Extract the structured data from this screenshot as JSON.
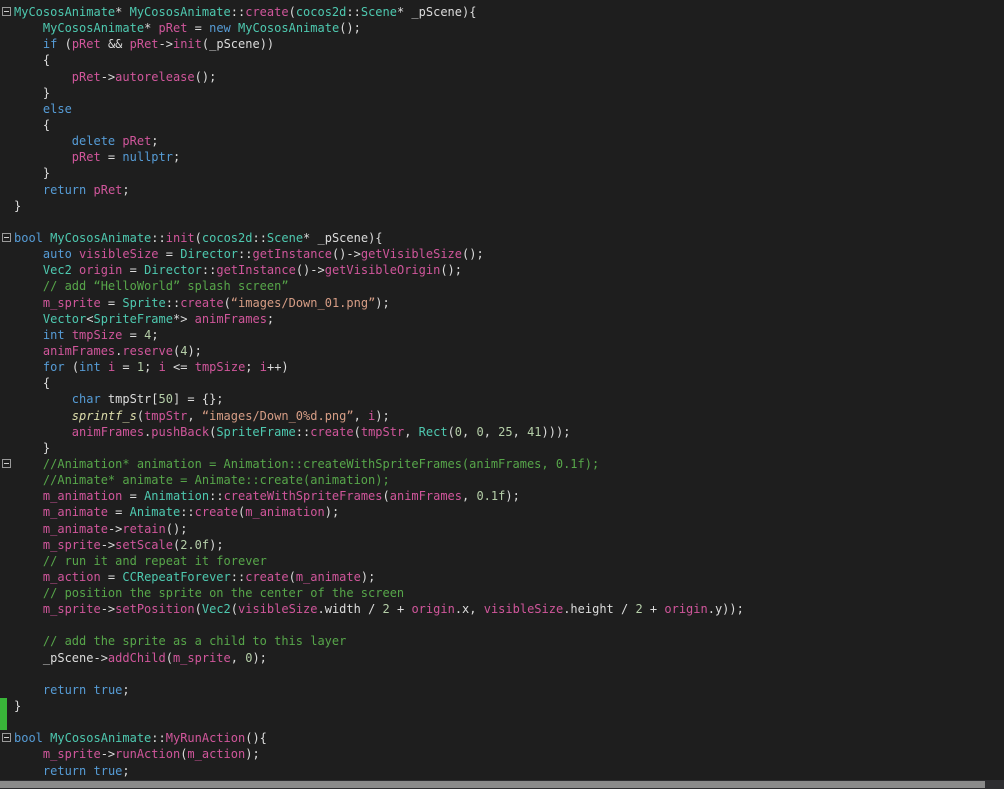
{
  "editor": {
    "colors": {
      "background": "#1E1E1E",
      "t": "#4EC9B0",
      "f": "#D0569B",
      "k": "#569CD6",
      "c": "#57A64A",
      "s": "#D69D85",
      "p": "#DCDCDC",
      "n": "#B5CEA8",
      "m": "#DCDCAA",
      "change": "#39B539",
      "foldborder": "#999999",
      "foldglyph": "#CCCCCC",
      "sbtrack": "#2D2D30",
      "sbthumb": "#8A8A8A"
    },
    "lines": [
      {
        "fold": true,
        "tokens": [
          [
            "t",
            "MyCososAnimate"
          ],
          [
            "p",
            "* "
          ],
          [
            "t",
            "MyCososAnimate"
          ],
          [
            "p",
            "::"
          ],
          [
            "f",
            "create"
          ],
          [
            "p",
            "("
          ],
          [
            "t",
            "cocos2d"
          ],
          [
            "p",
            "::"
          ],
          [
            "t",
            "Scene"
          ],
          [
            "p",
            "* _pScene){"
          ]
        ]
      },
      {
        "tokens": [
          [
            "p",
            "    "
          ],
          [
            "t",
            "MyCososAnimate"
          ],
          [
            "p",
            "* "
          ],
          [
            "f",
            "pRet"
          ],
          [
            "p",
            " = "
          ],
          [
            "k",
            "new"
          ],
          [
            "p",
            " "
          ],
          [
            "t",
            "MyCososAnimate"
          ],
          [
            "p",
            "();"
          ]
        ]
      },
      {
        "tokens": [
          [
            "p",
            "    "
          ],
          [
            "k",
            "if"
          ],
          [
            "p",
            " ("
          ],
          [
            "f",
            "pRet"
          ],
          [
            "p",
            " && "
          ],
          [
            "f",
            "pRet"
          ],
          [
            "p",
            "->"
          ],
          [
            "f",
            "init"
          ],
          [
            "p",
            "(_pScene))"
          ]
        ]
      },
      {
        "tokens": [
          [
            "p",
            "    {"
          ]
        ]
      },
      {
        "tokens": [
          [
            "p",
            "        "
          ],
          [
            "f",
            "pRet"
          ],
          [
            "p",
            "->"
          ],
          [
            "f",
            "autorelease"
          ],
          [
            "p",
            "();"
          ]
        ]
      },
      {
        "tokens": [
          [
            "p",
            "    }"
          ]
        ]
      },
      {
        "tokens": [
          [
            "p",
            "    "
          ],
          [
            "k",
            "else"
          ]
        ]
      },
      {
        "tokens": [
          [
            "p",
            "    {"
          ]
        ]
      },
      {
        "tokens": [
          [
            "p",
            "        "
          ],
          [
            "k",
            "delete"
          ],
          [
            "p",
            " "
          ],
          [
            "f",
            "pRet"
          ],
          [
            "p",
            ";"
          ]
        ]
      },
      {
        "tokens": [
          [
            "p",
            "        "
          ],
          [
            "f",
            "pRet"
          ],
          [
            "p",
            " = "
          ],
          [
            "k",
            "nullptr"
          ],
          [
            "p",
            ";"
          ]
        ]
      },
      {
        "tokens": [
          [
            "p",
            "    }"
          ]
        ]
      },
      {
        "tokens": [
          [
            "p",
            "    "
          ],
          [
            "k",
            "return"
          ],
          [
            "p",
            " "
          ],
          [
            "f",
            "pRet"
          ],
          [
            "p",
            ";"
          ]
        ]
      },
      {
        "tokens": [
          [
            "p",
            "}"
          ]
        ]
      },
      {
        "tokens": []
      },
      {
        "fold": true,
        "tokens": [
          [
            "k",
            "bool"
          ],
          [
            "p",
            " "
          ],
          [
            "t",
            "MyCososAnimate"
          ],
          [
            "p",
            "::"
          ],
          [
            "f",
            "init"
          ],
          [
            "p",
            "("
          ],
          [
            "t",
            "cocos2d"
          ],
          [
            "p",
            "::"
          ],
          [
            "t",
            "Scene"
          ],
          [
            "p",
            "* _pScene){"
          ]
        ]
      },
      {
        "tokens": [
          [
            "p",
            "    "
          ],
          [
            "k",
            "auto"
          ],
          [
            "p",
            " "
          ],
          [
            "f",
            "visibleSize"
          ],
          [
            "p",
            " = "
          ],
          [
            "t",
            "Director"
          ],
          [
            "p",
            "::"
          ],
          [
            "f",
            "getInstance"
          ],
          [
            "p",
            "()->"
          ],
          [
            "f",
            "getVisibleSize"
          ],
          [
            "p",
            "();"
          ]
        ]
      },
      {
        "tokens": [
          [
            "p",
            "    "
          ],
          [
            "t",
            "Vec2"
          ],
          [
            "p",
            " "
          ],
          [
            "f",
            "origin"
          ],
          [
            "p",
            " = "
          ],
          [
            "t",
            "Director"
          ],
          [
            "p",
            "::"
          ],
          [
            "f",
            "getInstance"
          ],
          [
            "p",
            "()->"
          ],
          [
            "f",
            "getVisibleOrigin"
          ],
          [
            "p",
            "();"
          ]
        ]
      },
      {
        "tokens": [
          [
            "p",
            "    "
          ],
          [
            "c",
            "// add “HelloWorld” splash screen”"
          ]
        ]
      },
      {
        "tokens": [
          [
            "p",
            "    "
          ],
          [
            "f",
            "m_sprite"
          ],
          [
            "p",
            " = "
          ],
          [
            "t",
            "Sprite"
          ],
          [
            "p",
            "::"
          ],
          [
            "f",
            "create"
          ],
          [
            "p",
            "("
          ],
          [
            "s",
            "“images/Down_01.png”"
          ],
          [
            "p",
            ");"
          ]
        ]
      },
      {
        "tokens": [
          [
            "p",
            "    "
          ],
          [
            "t",
            "Vector"
          ],
          [
            "p",
            "<"
          ],
          [
            "t",
            "SpriteFrame"
          ],
          [
            "p",
            "*> "
          ],
          [
            "f",
            "animFrames"
          ],
          [
            "p",
            ";"
          ]
        ]
      },
      {
        "tokens": [
          [
            "p",
            "    "
          ],
          [
            "k",
            "int"
          ],
          [
            "p",
            " "
          ],
          [
            "f",
            "tmpSize"
          ],
          [
            "p",
            " = "
          ],
          [
            "n",
            "4"
          ],
          [
            "p",
            ";"
          ]
        ]
      },
      {
        "tokens": [
          [
            "p",
            "    "
          ],
          [
            "f",
            "animFrames"
          ],
          [
            "p",
            "."
          ],
          [
            "f",
            "reserve"
          ],
          [
            "p",
            "("
          ],
          [
            "n",
            "4"
          ],
          [
            "p",
            ");"
          ]
        ]
      },
      {
        "tokens": [
          [
            "p",
            "    "
          ],
          [
            "k",
            "for"
          ],
          [
            "p",
            " ("
          ],
          [
            "k",
            "int"
          ],
          [
            "p",
            " "
          ],
          [
            "f",
            "i"
          ],
          [
            "p",
            " = "
          ],
          [
            "n",
            "1"
          ],
          [
            "p",
            "; "
          ],
          [
            "f",
            "i"
          ],
          [
            "p",
            " <= "
          ],
          [
            "f",
            "tmpSize"
          ],
          [
            "p",
            "; "
          ],
          [
            "f",
            "i"
          ],
          [
            "p",
            "++)"
          ]
        ]
      },
      {
        "tokens": [
          [
            "p",
            "    {"
          ]
        ]
      },
      {
        "tokens": [
          [
            "p",
            "        "
          ],
          [
            "k",
            "char"
          ],
          [
            "p",
            " tmpStr["
          ],
          [
            "n",
            "50"
          ],
          [
            "p",
            "] = {};"
          ]
        ]
      },
      {
        "tokens": [
          [
            "p",
            "        "
          ],
          [
            "m",
            "sprintf_s"
          ],
          [
            "p",
            "("
          ],
          [
            "f",
            "tmpStr"
          ],
          [
            "p",
            ", "
          ],
          [
            "s",
            "“images/Down_0%d.png”"
          ],
          [
            "p",
            ", "
          ],
          [
            "f",
            "i"
          ],
          [
            "p",
            ");"
          ]
        ]
      },
      {
        "tokens": [
          [
            "p",
            "        "
          ],
          [
            "f",
            "animFrames"
          ],
          [
            "p",
            "."
          ],
          [
            "f",
            "pushBack"
          ],
          [
            "p",
            "("
          ],
          [
            "t",
            "SpriteFrame"
          ],
          [
            "p",
            "::"
          ],
          [
            "f",
            "create"
          ],
          [
            "p",
            "("
          ],
          [
            "f",
            "tmpStr"
          ],
          [
            "p",
            ", "
          ],
          [
            "t",
            "Rect"
          ],
          [
            "p",
            "("
          ],
          [
            "n",
            "0"
          ],
          [
            "p",
            ", "
          ],
          [
            "n",
            "0"
          ],
          [
            "p",
            ", "
          ],
          [
            "n",
            "25"
          ],
          [
            "p",
            ", "
          ],
          [
            "n",
            "41"
          ],
          [
            "p",
            ")));"
          ]
        ]
      },
      {
        "tokens": [
          [
            "p",
            "    }"
          ]
        ]
      },
      {
        "fold": true,
        "tokens": [
          [
            "p",
            "    "
          ],
          [
            "c",
            "//Animation* animation = Animation::createWithSpriteFrames(animFrames, 0.1f);"
          ]
        ]
      },
      {
        "tokens": [
          [
            "p",
            "    "
          ],
          [
            "c",
            "//Animate* animate = Animate::create(animation);"
          ]
        ]
      },
      {
        "tokens": [
          [
            "p",
            "    "
          ],
          [
            "f",
            "m_animation"
          ],
          [
            "p",
            " = "
          ],
          [
            "t",
            "Animation"
          ],
          [
            "p",
            "::"
          ],
          [
            "f",
            "createWithSpriteFrames"
          ],
          [
            "p",
            "("
          ],
          [
            "f",
            "animFrames"
          ],
          [
            "p",
            ", "
          ],
          [
            "n",
            "0.1f"
          ],
          [
            "p",
            ");"
          ]
        ]
      },
      {
        "tokens": [
          [
            "p",
            "    "
          ],
          [
            "f",
            "m_animate"
          ],
          [
            "p",
            " = "
          ],
          [
            "t",
            "Animate"
          ],
          [
            "p",
            "::"
          ],
          [
            "f",
            "create"
          ],
          [
            "p",
            "("
          ],
          [
            "f",
            "m_animation"
          ],
          [
            "p",
            ");"
          ]
        ]
      },
      {
        "tokens": [
          [
            "p",
            "    "
          ],
          [
            "f",
            "m_animate"
          ],
          [
            "p",
            "->"
          ],
          [
            "f",
            "retain"
          ],
          [
            "p",
            "();"
          ]
        ]
      },
      {
        "tokens": [
          [
            "p",
            "    "
          ],
          [
            "f",
            "m_sprite"
          ],
          [
            "p",
            "->"
          ],
          [
            "f",
            "setScale"
          ],
          [
            "p",
            "("
          ],
          [
            "n",
            "2.0f"
          ],
          [
            "p",
            ");"
          ]
        ]
      },
      {
        "tokens": [
          [
            "p",
            "    "
          ],
          [
            "c",
            "// run it and repeat it forever"
          ]
        ]
      },
      {
        "tokens": [
          [
            "p",
            "    "
          ],
          [
            "f",
            "m_action"
          ],
          [
            "p",
            " = "
          ],
          [
            "t",
            "CCRepeatForever"
          ],
          [
            "p",
            "::"
          ],
          [
            "f",
            "create"
          ],
          [
            "p",
            "("
          ],
          [
            "f",
            "m_animate"
          ],
          [
            "p",
            ");"
          ]
        ]
      },
      {
        "tokens": [
          [
            "p",
            "    "
          ],
          [
            "c",
            "// position the sprite on the center of the screen"
          ]
        ]
      },
      {
        "tokens": [
          [
            "p",
            "    "
          ],
          [
            "f",
            "m_sprite"
          ],
          [
            "p",
            "->"
          ],
          [
            "f",
            "setPosition"
          ],
          [
            "p",
            "("
          ],
          [
            "t",
            "Vec2"
          ],
          [
            "p",
            "("
          ],
          [
            "f",
            "visibleSize"
          ],
          [
            "p",
            ".width / "
          ],
          [
            "n",
            "2"
          ],
          [
            "p",
            " + "
          ],
          [
            "f",
            "origin"
          ],
          [
            "p",
            ".x, "
          ],
          [
            "f",
            "visibleSize"
          ],
          [
            "p",
            ".height / "
          ],
          [
            "n",
            "2"
          ],
          [
            "p",
            " + "
          ],
          [
            "f",
            "origin"
          ],
          [
            "p",
            ".y));"
          ]
        ]
      },
      {
        "tokens": []
      },
      {
        "tokens": [
          [
            "p",
            "    "
          ],
          [
            "c",
            "// add the sprite as a child to this layer"
          ]
        ]
      },
      {
        "tokens": [
          [
            "p",
            "    _pScene->"
          ],
          [
            "f",
            "addChild"
          ],
          [
            "p",
            "("
          ],
          [
            "f",
            "m_sprite"
          ],
          [
            "p",
            ", "
          ],
          [
            "n",
            "0"
          ],
          [
            "p",
            ");"
          ]
        ]
      },
      {
        "tokens": []
      },
      {
        "tokens": [
          [
            "p",
            "    "
          ],
          [
            "k",
            "return"
          ],
          [
            "p",
            " "
          ],
          [
            "k",
            "true"
          ],
          [
            "p",
            ";"
          ]
        ]
      },
      {
        "change": true,
        "tokens": [
          [
            "p",
            "}"
          ]
        ]
      },
      {
        "change": true,
        "tokens": []
      },
      {
        "fold": true,
        "tokens": [
          [
            "k",
            "bool"
          ],
          [
            "p",
            " "
          ],
          [
            "t",
            "MyCososAnimate"
          ],
          [
            "p",
            "::"
          ],
          [
            "f",
            "MyRunAction"
          ],
          [
            "p",
            "(){"
          ]
        ]
      },
      {
        "tokens": [
          [
            "p",
            "    "
          ],
          [
            "f",
            "m_sprite"
          ],
          [
            "p",
            "->"
          ],
          [
            "f",
            "runAction"
          ],
          [
            "p",
            "("
          ],
          [
            "f",
            "m_action"
          ],
          [
            "p",
            ");"
          ]
        ]
      },
      {
        "tokens": [
          [
            "p",
            "    "
          ],
          [
            "k",
            "return"
          ],
          [
            "p",
            " "
          ],
          [
            "k",
            "true"
          ],
          [
            "p",
            ";"
          ]
        ]
      },
      {
        "tokens": [
          [
            "p",
            "}"
          ]
        ]
      }
    ]
  }
}
